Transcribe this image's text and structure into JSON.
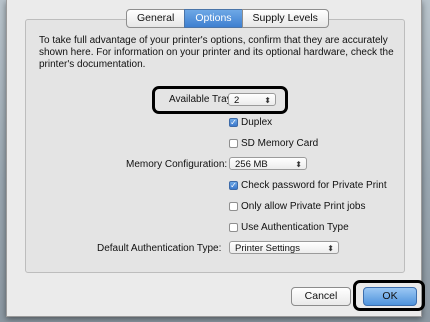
{
  "tabs": [
    {
      "label": "General",
      "active": false
    },
    {
      "label": "Options",
      "active": true
    },
    {
      "label": "Supply Levels",
      "active": false
    }
  ],
  "intro_text": "To take full advantage of your printer's options, confirm that they are accurately shown here. For information on your printer and its optional hardware, check the printer's documentation.",
  "fields": {
    "available_tray_label": "Available Tray:",
    "available_tray_value": "2",
    "duplex_label": "Duplex",
    "duplex_checked": true,
    "sd_card_label": "SD Memory Card",
    "sd_card_checked": false,
    "memory_label": "Memory Configuration:",
    "memory_value": "256 MB",
    "check_password_label": "Check password for Private Print",
    "check_password_checked": true,
    "only_private_label": "Only allow Private Print jobs",
    "only_private_checked": false,
    "use_auth_label": "Use Authentication Type",
    "use_auth_checked": false,
    "auth_type_label": "Default Authentication Type:",
    "auth_type_value": "Printer Settings"
  },
  "buttons": {
    "cancel": "Cancel",
    "ok": "OK"
  },
  "icons": {
    "checkmark": "✓",
    "popup_arrows": "⬍"
  },
  "colors": {
    "accent": "#3e7fd0",
    "highlight_ring": "#000000"
  }
}
